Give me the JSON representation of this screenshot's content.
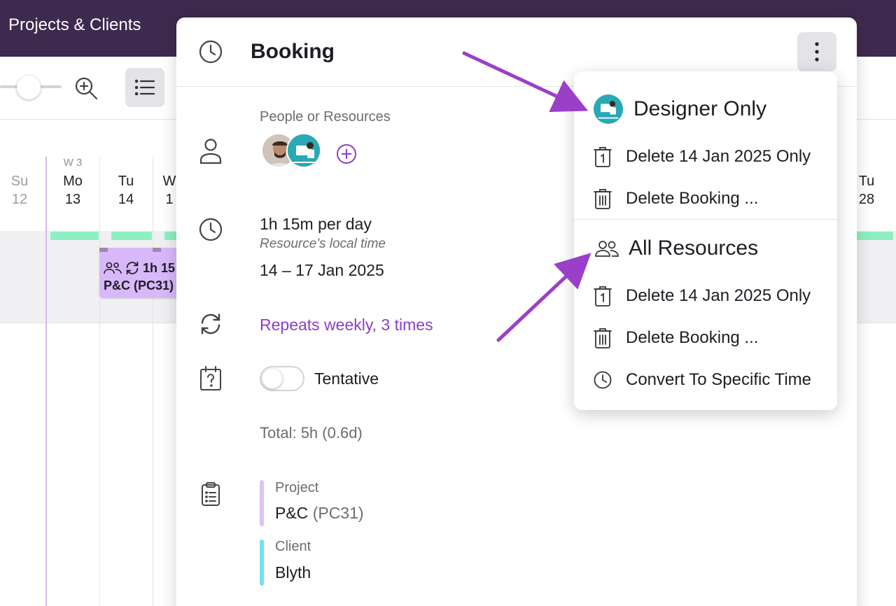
{
  "app": {
    "title": "Projects & Clients"
  },
  "calendar": {
    "week_label": "W 3",
    "days": [
      {
        "name": "Su",
        "num": "12"
      },
      {
        "name": "Mo",
        "num": "13"
      },
      {
        "name": "Tu",
        "num": "14"
      },
      {
        "name": "W",
        "num": "1"
      },
      {
        "name": "Tu",
        "num": "28"
      }
    ],
    "chip": {
      "hours": "1h 15",
      "project": "P&C (PC31)"
    }
  },
  "booking": {
    "title": "Booking",
    "people_label": "People or Resources",
    "hours_per_day": "1h 15m per day",
    "local_time_note": "Resource's local time",
    "date_range": "14 – 17 Jan 2025",
    "repeats": "Repeats weekly, 3 times",
    "tentative_label": "Tentative",
    "tentative_on": false,
    "total": "Total: 5h (0.6d)",
    "project_label": "Project",
    "project_name": "P&C",
    "project_code": "(PC31)",
    "client_label": "Client",
    "client_name": "Blyth"
  },
  "menu": {
    "designer_heading": "Designer Only",
    "designer_items": [
      "Delete 14 Jan 2025 Only",
      "Delete Booking ..."
    ],
    "all_heading": "All Resources",
    "all_items": [
      "Delete 14 Jan 2025 Only",
      "Delete Booking ...",
      "Convert To Specific Time"
    ]
  },
  "colors": {
    "topbar": "#3f2a4f",
    "accent_purple": "#8e3fc4",
    "annotation_arrow": "#9b3fc9",
    "availability_green": "#8ef0c2",
    "chip_purple": "#d8b8fb",
    "project_bar": "#dcc2f7",
    "client_bar": "#6fe3f2"
  },
  "icons": [
    "zoom-in-icon",
    "list-icon",
    "clock-icon",
    "person-icon",
    "repeat-icon",
    "calendar-question-icon",
    "clipboard-list-icon",
    "kebab-icon",
    "trash-single-day-icon",
    "trash-icon",
    "group-icon",
    "add-circle-icon"
  ]
}
